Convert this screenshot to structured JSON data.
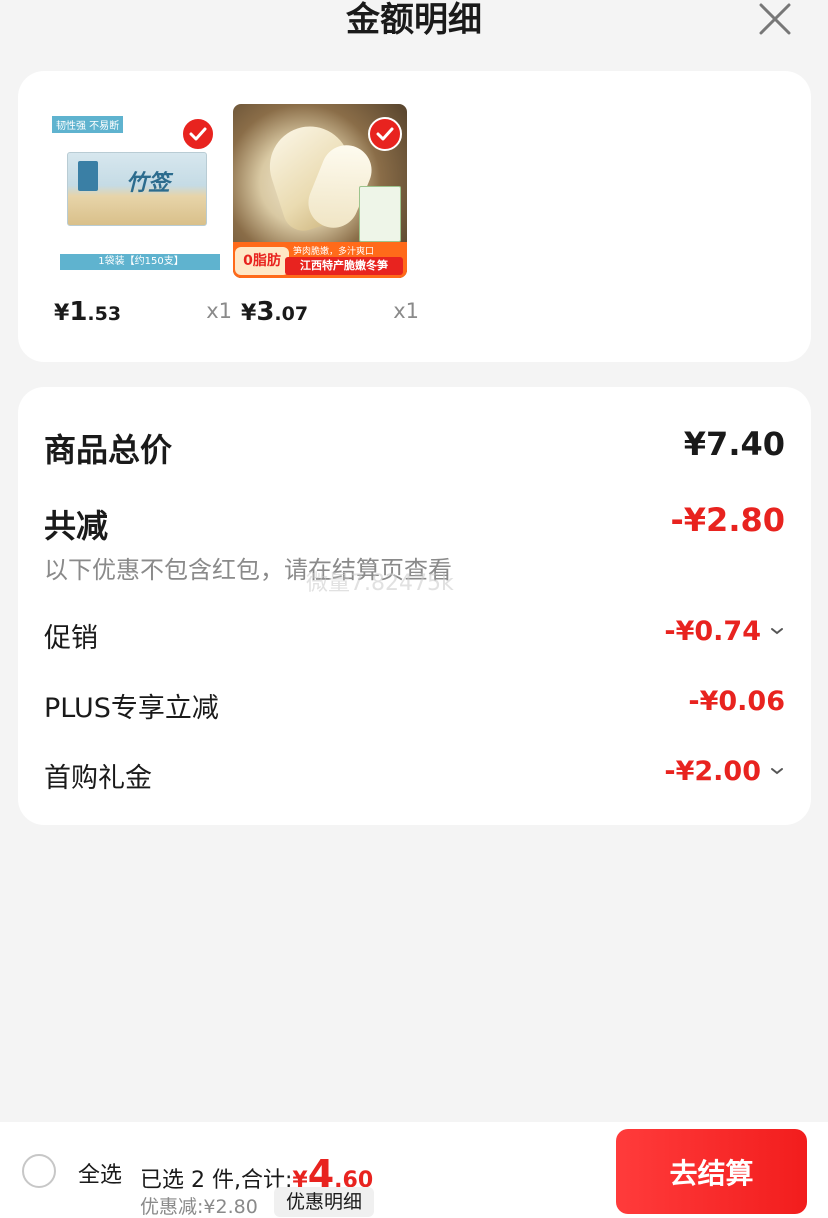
{
  "header": {
    "title": "金额明细"
  },
  "products": [
    {
      "tag": "韧性强 不易断",
      "name": "竹签",
      "band": "1袋装【约150支】",
      "price_yen": "¥",
      "price_int": "1",
      "price_dec": ".53",
      "qty": "x1"
    },
    {
      "badge": "0脂肪",
      "sub": "笋肉脆嫩，多汁爽口",
      "title": "江西特产脆嫩冬笋",
      "price_yen": "¥",
      "price_int": "3",
      "price_dec": ".07",
      "qty": "x1"
    }
  ],
  "summary": {
    "total_label": "商品总价",
    "total_value": "¥7.40",
    "reduce_label": "共减",
    "reduce_value": "-¥2.80",
    "note": "以下优惠不包含红包，请在结算页查看",
    "watermark": "微量7.82475k",
    "items": [
      {
        "label": "促销",
        "value": "-¥0.74",
        "expandable": true
      },
      {
        "label": "PLUS专享立减",
        "value": "-¥0.06",
        "expandable": false
      },
      {
        "label": "首购礼金",
        "value": "-¥2.00",
        "expandable": true
      }
    ]
  },
  "bottom": {
    "select_all": "全选",
    "selected_text": "已选 2 件,合计:",
    "total_yen": "¥",
    "total_int": "4",
    "total_dec": ".60",
    "discount_text": "优惠减:¥2.80",
    "detail_chip": "优惠明细",
    "checkout": "去结算"
  },
  "colors": {
    "accent_red": "#e8231f",
    "checkout_red": "#f21d1d",
    "background": "#f4f4f4"
  },
  "icons": {
    "close": "close-icon",
    "check": "check-icon",
    "chevron": "chevron-down-icon"
  }
}
